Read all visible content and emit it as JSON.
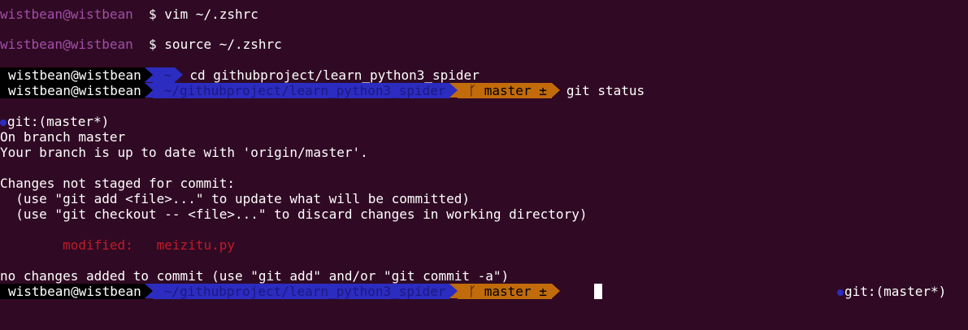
{
  "history": [
    {
      "prompt": "wistbean@wistbean",
      "command": "$ vim ~/.zshrc"
    },
    {
      "prompt": "wistbean@wistbean",
      "command": "$ source ~/.zshrc"
    }
  ],
  "pl_prompt_1": {
    "user": "wistbean@wistbean",
    "dir": "~",
    "command": "cd githubproject/learn_python3_spider"
  },
  "pl_prompt_2": {
    "user": "wistbean@wistbean",
    "dir": "~/githubproject/learn_python3_spider",
    "git": "ᚴ master ±",
    "command": "git status"
  },
  "output": {
    "git_indicator": "git:(master*)",
    "lines": [
      "On branch master",
      "Your branch is up to date with 'origin/master'.",
      "",
      "Changes not staged for commit:",
      "  (use \"git add <file>...\" to update what will be committed)",
      "  (use \"git checkout -- <file>...\" to discard changes in working directory)"
    ],
    "modified_line": "        modified:   meizitu.py",
    "summary": "no changes added to commit (use \"git add\" and/or \"git commit -a\")"
  },
  "pl_prompt_3": {
    "user": "wistbean@wistbean",
    "dir": "~/githubproject/learn_python3_spider",
    "git": "ᚴ master ±"
  },
  "right_prompt": "git:(master*)",
  "colors": {
    "background": "#300a24",
    "user_segment": "#000000",
    "dir_segment": "#2c2cc1",
    "git_segment": "#c16b0b",
    "prompt_purple": "#a24ea9",
    "modified_red": "#c01c28"
  }
}
